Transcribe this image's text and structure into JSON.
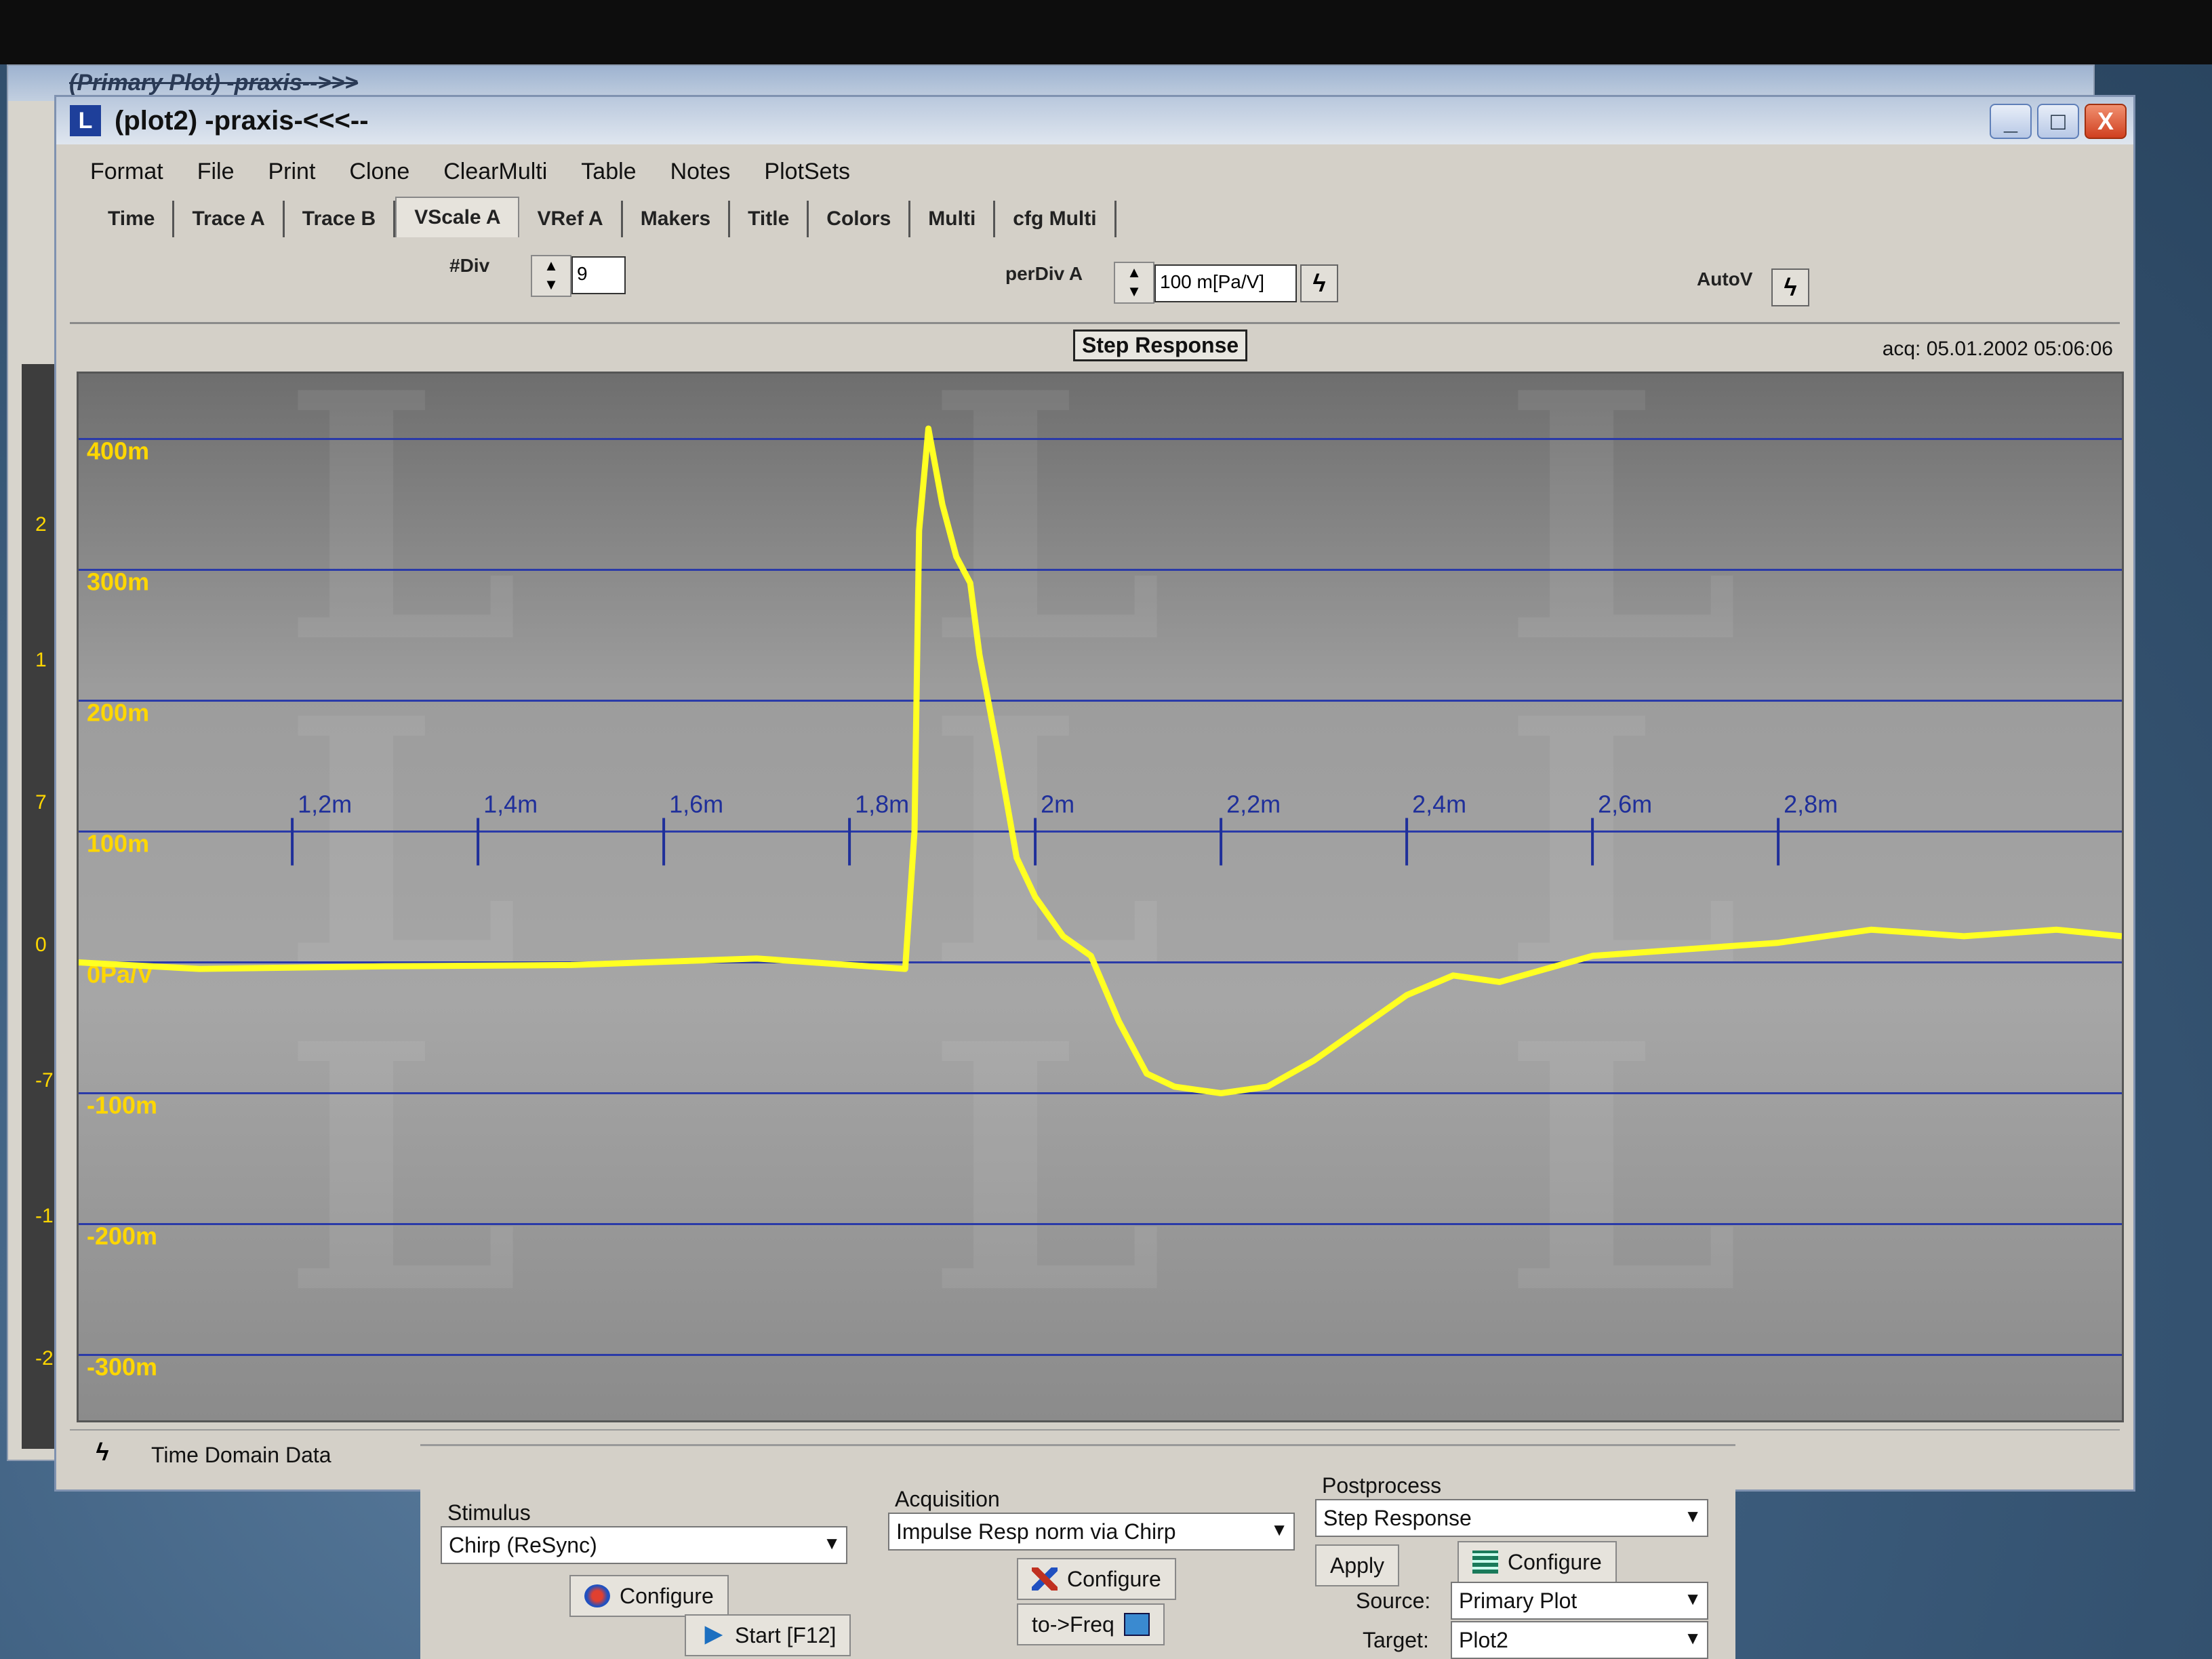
{
  "background_window": {
    "title": "(Primary Plot) -praxis-->>>",
    "side_labels": [
      "2",
      "1",
      "7",
      "0",
      "-7",
      "-1",
      "-2"
    ]
  },
  "window": {
    "title": "(plot2) -praxis-<<<--",
    "icon_letter": "L",
    "controls": {
      "minimize": "_",
      "maximize": "□",
      "close": "X"
    }
  },
  "menu": [
    "Format",
    "File",
    "Print",
    "Clone",
    "ClearMulti",
    "Table",
    "Notes",
    "PlotSets"
  ],
  "tabs": [
    "Time",
    "Trace A",
    "Trace B",
    "VScale A",
    "VRef A",
    "Makers",
    "Title",
    "Colors",
    "Multi",
    "cfg Multi"
  ],
  "active_tab": "VScale A",
  "toolbar": {
    "ndiv_label": "#Div",
    "ndiv_value": "9",
    "perdiv_label": "perDiv A",
    "perdiv_value": "100 m[Pa/V]",
    "autov_label": "AutoV"
  },
  "plot": {
    "title": "Step Response",
    "acq": "acq: 05.01.2002 05:06:06"
  },
  "chart_data": {
    "type": "line",
    "title": "Step Response",
    "y_tick_labels": [
      "400m",
      "300m",
      "200m",
      "100m",
      "0Pa/V",
      "-100m",
      "-200m",
      "-300m"
    ],
    "y_ticks": [
      400,
      300,
      200,
      100,
      0,
      -100,
      -200,
      -300
    ],
    "x_tick_labels": [
      "1,2m",
      "1,4m",
      "1,6m",
      "1,8m",
      "2m",
      "2,2m",
      "2,4m",
      "2,6m",
      "2,8m"
    ],
    "x_ticks": [
      1.2,
      1.4,
      1.6,
      1.8,
      2.0,
      2.2,
      2.4,
      2.6,
      2.8
    ],
    "xlim": [
      0.97,
      3.17
    ],
    "ylim": [
      -350,
      450
    ],
    "grid": true,
    "colors": {
      "trace": "#ffff22",
      "grid": "#2a3aa8",
      "labels": "#ffd700",
      "xlabels": "#1f2f9a"
    },
    "series": [
      {
        "x": [
          0.97,
          1.1,
          1.3,
          1.5,
          1.7,
          1.86,
          1.87,
          1.875,
          1.885,
          1.9,
          1.915,
          1.93,
          1.94,
          1.96,
          1.98,
          2.0,
          2.03,
          2.06,
          2.09,
          2.12,
          2.15,
          2.2,
          2.25,
          2.3,
          2.35,
          2.4,
          2.45,
          2.5,
          2.55,
          2.6,
          2.7,
          2.8,
          2.9,
          3.0,
          3.1,
          3.17
        ],
        "y": [
          0,
          -5,
          -3,
          -2,
          3,
          -5,
          100,
          330,
          408,
          350,
          310,
          290,
          235,
          160,
          80,
          50,
          20,
          5,
          -45,
          -85,
          -95,
          -100,
          -95,
          -75,
          -50,
          -25,
          -10,
          -15,
          -5,
          5,
          10,
          15,
          25,
          20,
          25,
          20
        ]
      }
    ]
  },
  "status": {
    "text": "Time Domain Data"
  },
  "panel": {
    "stimulus": {
      "title": "Stimulus",
      "value": "Chirp (ReSync)",
      "configure": "Configure"
    },
    "acquisition": {
      "title": "Acquisition",
      "value": "Impulse Resp norm via Chirp",
      "configure": "Configure"
    },
    "postprocess": {
      "title": "Postprocess",
      "value": "Step Response",
      "apply": "Apply",
      "configure": "Configure"
    },
    "start": "Start [F12]",
    "to_freq": "to->Freq",
    "source_label": "Source:",
    "source_value": "Primary Plot",
    "target_label": "Target:",
    "target_value": "Plot2"
  }
}
